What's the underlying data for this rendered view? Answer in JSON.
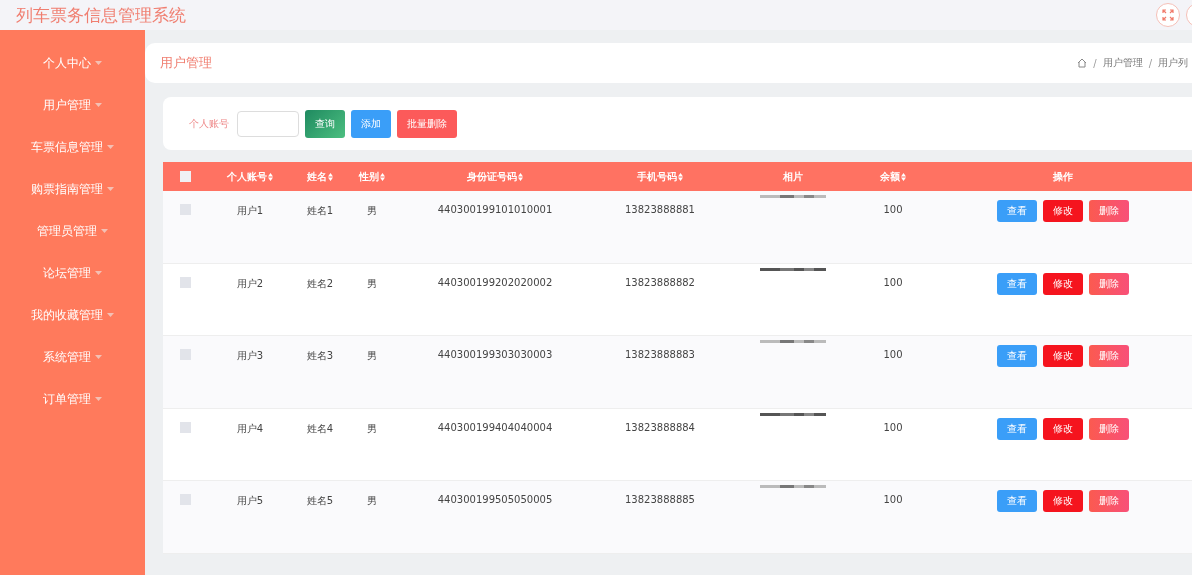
{
  "app_title": "列车票务信息管理系统",
  "sidebar": {
    "items": [
      {
        "label": "个人中心"
      },
      {
        "label": "用户管理"
      },
      {
        "label": "车票信息管理"
      },
      {
        "label": "购票指南管理"
      },
      {
        "label": "管理员管理"
      },
      {
        "label": "论坛管理"
      },
      {
        "label": "我的收藏管理"
      },
      {
        "label": "系统管理"
      },
      {
        "label": "订单管理"
      }
    ]
  },
  "page_title": "用户管理",
  "breadcrumb": [
    {
      "separator": "/",
      "label": "用户管理"
    },
    {
      "separator": "/",
      "label": "用户列"
    }
  ],
  "search": {
    "label": "个人账号",
    "buttons": [
      {
        "label": "查询",
        "kind": "query"
      },
      {
        "label": "添加",
        "kind": "add"
      },
      {
        "label": "批量删除",
        "kind": "delete"
      }
    ]
  },
  "table": {
    "header_checked": false,
    "columns": [
      {
        "label": "个人账号",
        "sortable": true
      },
      {
        "label": "姓名",
        "sortable": true
      },
      {
        "label": "性别",
        "sortable": true
      },
      {
        "label": "身份证号码",
        "sortable": true
      },
      {
        "label": "手机号码",
        "sortable": true
      },
      {
        "label": "相片",
        "sortable": false
      },
      {
        "label": "余额",
        "sortable": true
      },
      {
        "label": "操作",
        "sortable": false
      }
    ],
    "rows": [
      {
        "checked": false,
        "cells": [
          "用户1",
          "姓名1",
          "男",
          "440300199101010001",
          "13823888881"
        ],
        "balance": "100",
        "actions": [
          "查看",
          "修改",
          "删除"
        ]
      },
      {
        "checked": false,
        "cells": [
          "用户2",
          "姓名2",
          "男",
          "440300199202020002",
          "13823888882"
        ],
        "balance": "100",
        "actions": [
          "查看",
          "修改",
          "删除"
        ]
      },
      {
        "checked": false,
        "cells": [
          "用户3",
          "姓名3",
          "男",
          "440300199303030003",
          "13823888883"
        ],
        "balance": "100",
        "actions": [
          "查看",
          "修改",
          "删除"
        ]
      },
      {
        "checked": false,
        "cells": [
          "用户4",
          "姓名4",
          "男",
          "440300199404040004",
          "13823888884"
        ],
        "balance": "100",
        "actions": [
          "查看",
          "修改",
          "删除"
        ]
      },
      {
        "checked": false,
        "cells": [
          "用户5",
          "姓名5",
          "男",
          "440300199505050005",
          "13823888885"
        ],
        "balance": "100",
        "actions": [
          "查看",
          "修改",
          "删除"
        ]
      }
    ]
  }
}
